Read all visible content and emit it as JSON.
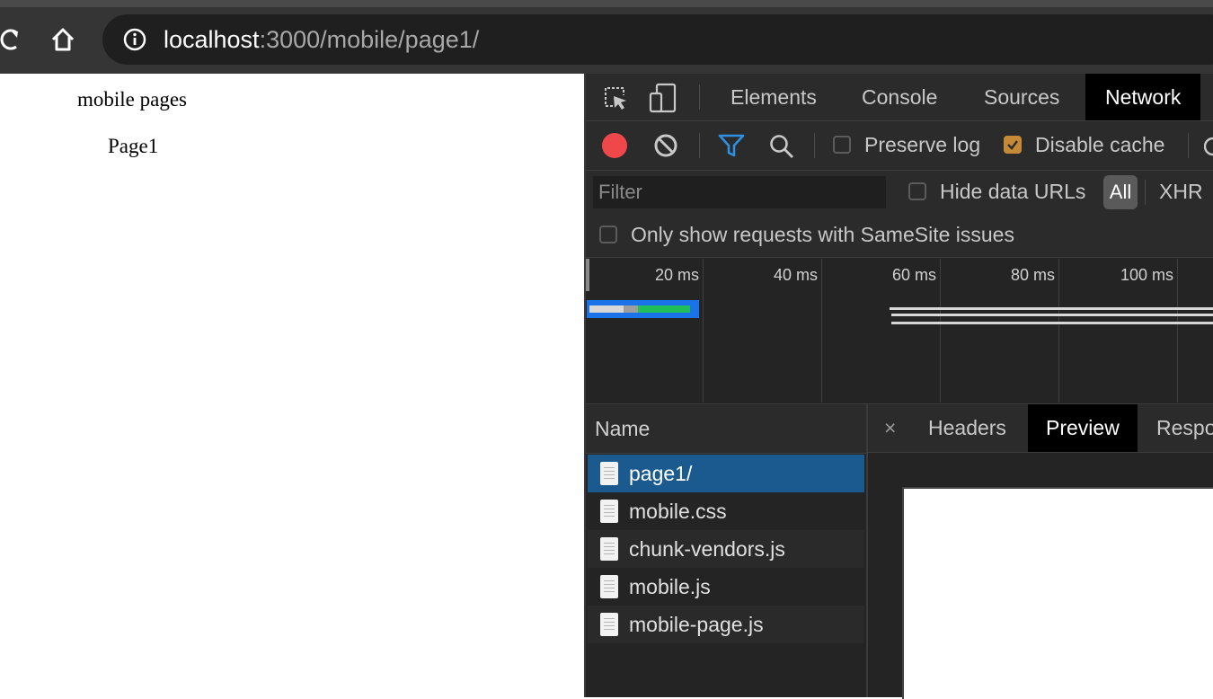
{
  "browser": {
    "url_host": "localhost",
    "url_path": ":3000/mobile/page1/"
  },
  "page": {
    "heading": "mobile pages",
    "link": "Page1"
  },
  "devtools": {
    "tabs": [
      "Elements",
      "Console",
      "Sources",
      "Network"
    ],
    "active_tab": "Network",
    "toolbar": {
      "preserve_log": "Preserve log",
      "preserve_log_checked": false,
      "disable_cache": "Disable cache",
      "disable_cache_checked": true,
      "record_color": "#f0484a",
      "filter_icon_color": "#2f8fe0"
    },
    "filterbar": {
      "filter_placeholder": "Filter",
      "hide_data_urls": "Hide data URLs",
      "type_all": "All",
      "type_xhr": "XHR",
      "samesite": "Only show requests with SameSite issues"
    },
    "overview": {
      "ticks": [
        "20 ms",
        "40 ms",
        "60 ms",
        "80 ms",
        "100 ms"
      ]
    },
    "requests": {
      "header": "Name",
      "items": [
        "page1/",
        "mobile.css",
        "chunk-vendors.js",
        "mobile.js",
        "mobile-page.js"
      ],
      "selected": "page1/"
    },
    "detail": {
      "close": "×",
      "tabs": [
        "Headers",
        "Preview",
        "Respo"
      ],
      "active_tab": "Preview"
    }
  }
}
